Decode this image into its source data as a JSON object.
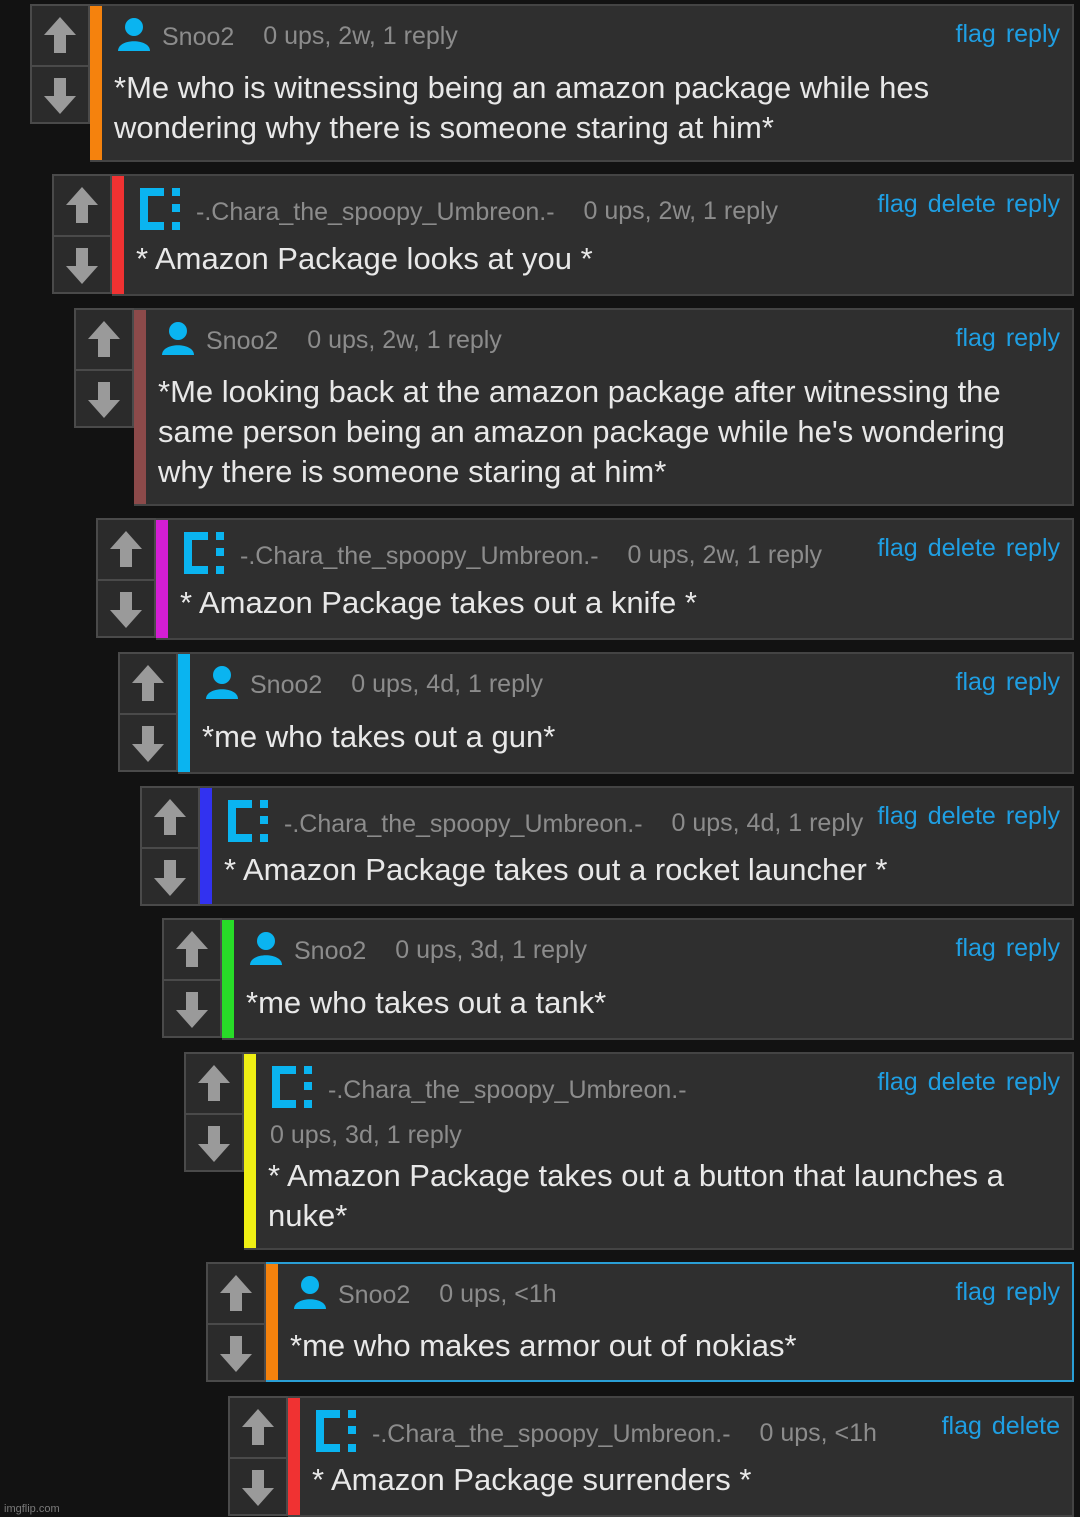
{
  "comments": [
    {
      "user": "Snoo2",
      "avatar": "person-icon",
      "meta": "0 ups, 2w, 1 reply",
      "actions": [
        "flag",
        "reply"
      ],
      "text": "*Me who is witnessing being an amazon package while hes wondering why there is someone staring at him*",
      "bar_color": "#f5820d"
    },
    {
      "user": "-.Chara_the_spoopy_Umbreon.-",
      "avatar": "bracket-avatar-icon",
      "meta": "0 ups, 2w, 1 reply",
      "actions": [
        "flag",
        "delete",
        "reply"
      ],
      "text": "* Amazon Package looks at you *",
      "bar_color": "#f03232"
    },
    {
      "user": "Snoo2",
      "avatar": "person-icon",
      "meta": "0 ups, 2w, 1 reply",
      "actions": [
        "flag",
        "reply"
      ],
      "text": "*Me looking back at the amazon package after witnessing the same person being an amazon package while he's wondering why there is someone staring at him*",
      "bar_color": "#8c4a4a"
    },
    {
      "user": "-.Chara_the_spoopy_Umbreon.-",
      "avatar": "bracket-avatar-icon",
      "meta": "0 ups, 2w, 1 reply",
      "actions": [
        "flag",
        "delete",
        "reply"
      ],
      "text": "* Amazon Package takes out a knife *",
      "bar_color": "#d41ed4"
    },
    {
      "user": "Snoo2",
      "avatar": "person-icon",
      "meta": "0 ups, 4d, 1 reply",
      "actions": [
        "flag",
        "reply"
      ],
      "text": "*me who takes out a gun*",
      "bar_color": "#0ab4f0"
    },
    {
      "user": "-.Chara_the_spoopy_Umbreon.-",
      "avatar": "bracket-avatar-icon",
      "meta": "0 ups, 4d, 1 reply",
      "actions": [
        "flag",
        "delete",
        "reply"
      ],
      "text": "* Amazon Package takes out a rocket launcher *",
      "bar_color": "#3232f0"
    },
    {
      "user": "Snoo2",
      "avatar": "person-icon",
      "meta": "0 ups, 3d, 1 reply",
      "actions": [
        "flag",
        "reply"
      ],
      "text": "*me who takes out a tank*",
      "bar_color": "#28dc28"
    },
    {
      "user": "-.Chara_the_spoopy_Umbreon.-",
      "avatar": "bracket-avatar-icon",
      "meta": "0 ups, 3d, 1 reply",
      "actions": [
        "flag",
        "delete",
        "reply"
      ],
      "text": "* Amazon Package takes out a button that launches a nuke*",
      "bar_color": "#f0f014"
    },
    {
      "user": "Snoo2",
      "avatar": "person-icon",
      "meta": "0 ups, <1h",
      "actions": [
        "flag",
        "reply"
      ],
      "text": "*me who makes armor out of nokias*",
      "bar_color": "#f5820d"
    },
    {
      "user": "-.Chara_the_spoopy_Umbreon.-",
      "avatar": "bracket-avatar-icon",
      "meta": "0 ups, <1h",
      "actions": [
        "flag",
        "delete"
      ],
      "text": "* Amazon Package surrenders *",
      "bar_color": "#f03232"
    }
  ],
  "colors": {
    "link": "#1f9fe3",
    "background": "#121212",
    "panel": "#2f2f2f",
    "text": "#e8e8e8",
    "muted": "#8c8c8c"
  },
  "watermark": "imgflip.com"
}
